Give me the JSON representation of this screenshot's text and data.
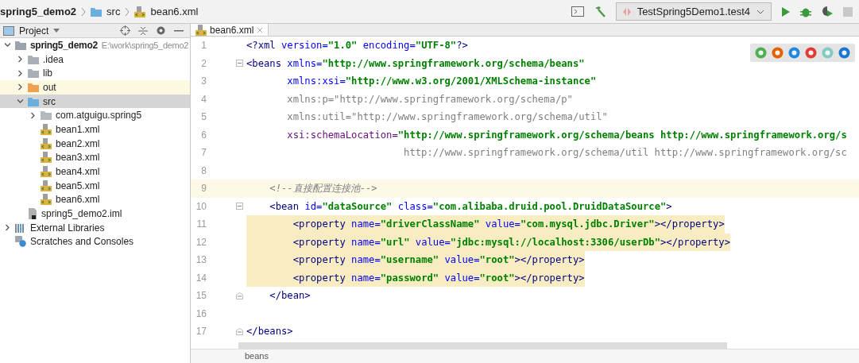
{
  "breadcrumb": [
    {
      "kind": "module",
      "label": "spring5_demo2"
    },
    {
      "kind": "folder",
      "label": "src"
    },
    {
      "kind": "xml",
      "label": "bean6.xml"
    }
  ],
  "run_config": {
    "label": "TestSpring5Demo1.test4"
  },
  "project_panel": {
    "title": "Project"
  },
  "tree": [
    {
      "kind": "module",
      "label": "spring5_demo2",
      "path": "E:\\work\\spring5_demo2",
      "expanded": true,
      "selected": false,
      "children": [
        {
          "kind": "folder",
          "label": ".idea",
          "expanded": false,
          "selected": false
        },
        {
          "kind": "folder",
          "label": "lib",
          "expanded": false,
          "selected": false
        },
        {
          "kind": "excluded",
          "label": "out",
          "expanded": false,
          "selected": false
        },
        {
          "kind": "source",
          "label": "src",
          "expanded": true,
          "selected": true,
          "children": [
            {
              "kind": "package",
              "label": "com.atguigu.spring5",
              "expanded": false,
              "selected": false
            },
            {
              "kind": "xml",
              "label": "bean1.xml",
              "selected": false
            },
            {
              "kind": "xml",
              "label": "bean2.xml",
              "selected": false
            },
            {
              "kind": "xml",
              "label": "bean3.xml",
              "selected": false
            },
            {
              "kind": "xml",
              "label": "bean4.xml",
              "selected": false
            },
            {
              "kind": "xml",
              "label": "bean5.xml",
              "selected": false
            },
            {
              "kind": "xml",
              "label": "bean6.xml",
              "selected": false
            }
          ]
        },
        {
          "kind": "iml",
          "label": "spring5_demo2.iml",
          "selected": false
        }
      ]
    },
    {
      "kind": "libraries",
      "label": "External Libraries",
      "expanded": false,
      "selected": false
    },
    {
      "kind": "scratches",
      "label": "Scratches and Consoles",
      "selected": false
    }
  ],
  "tabs": [
    {
      "label": "bean6.xml",
      "selected": true
    }
  ],
  "code": [
    {
      "number": "1",
      "current": false,
      "matched": false,
      "tokens": [
        {
          "kind": "tag",
          "text": "<?xml"
        },
        {
          "kind": "attr",
          "text": " version="
        },
        {
          "kind": "value",
          "text": "\"1.0\""
        },
        {
          "kind": "attr",
          "text": " encoding="
        },
        {
          "kind": "value",
          "text": "\"UTF-8\""
        },
        {
          "kind": "tag",
          "text": "?>"
        }
      ]
    },
    {
      "number": "2",
      "current": false,
      "matched": false,
      "fold": {
        "kind": "open"
      },
      "tokens": [
        {
          "kind": "tag",
          "text": "<beans"
        },
        {
          "kind": "attr",
          "text": " xmlns="
        },
        {
          "kind": "value",
          "text": "\"http://www.springframework.org/schema/beans\""
        }
      ]
    },
    {
      "number": "3",
      "current": false,
      "matched": false,
      "tokens": [
        {
          "kind": "attr",
          "text": "       xmlns:xsi="
        },
        {
          "kind": "value",
          "text": "\"http://www.w3.org/2001/XMLSchema-instance\""
        }
      ]
    },
    {
      "number": "4",
      "current": false,
      "matched": false,
      "tokens": [
        {
          "kind": "unused",
          "text": "       xmlns:p=\"http://www.springframework.org/schema/p\""
        }
      ]
    },
    {
      "number": "5",
      "current": false,
      "matched": false,
      "tokens": [
        {
          "kind": "unused",
          "text": "       xmlns:util=\"http://www.springframework.org/schema/util\""
        }
      ]
    },
    {
      "number": "6",
      "current": false,
      "matched": false,
      "tokens": [
        {
          "kind": "namespace",
          "text": "       xsi:schemaLocation="
        },
        {
          "kind": "value",
          "text": "\"http://www.springframework.org/schema/beans http://www.springframework.org/s"
        }
      ]
    },
    {
      "number": "7",
      "current": false,
      "matched": false,
      "tokens": [
        {
          "kind": "unused",
          "text": "                           http://www.springframework.org/schema/util http://www.springframework.org/sc"
        }
      ]
    },
    {
      "number": "8",
      "current": false,
      "matched": false
    },
    {
      "number": "9",
      "current": true,
      "matched": false,
      "tokens": [
        {
          "kind": "comment",
          "text": "    <!--直接配置连接池-->"
        }
      ]
    },
    {
      "number": "10",
      "current": false,
      "matched": false,
      "fold": {
        "kind": "open"
      },
      "tokens": [
        {
          "kind": "tag",
          "text": "    <bean"
        },
        {
          "kind": "attr",
          "text": " id="
        },
        {
          "kind": "value",
          "text": "\"dataSource\""
        },
        {
          "kind": "attr",
          "text": " class="
        },
        {
          "kind": "value",
          "text": "\"com.alibaba.druid.pool.DruidDataSource\""
        },
        {
          "kind": "tag",
          "text": ">"
        }
      ]
    },
    {
      "number": "11",
      "current": false,
      "matched": true,
      "tokens": [
        {
          "kind": "tag",
          "text": "        <property"
        },
        {
          "kind": "attr",
          "text": " name="
        },
        {
          "kind": "value",
          "text": "\"driverClassName\""
        },
        {
          "kind": "attr",
          "text": " value="
        },
        {
          "kind": "value",
          "text": "\"com.mysql.jdbc.Driver\""
        },
        {
          "kind": "tag",
          "text": "></property>"
        }
      ]
    },
    {
      "number": "12",
      "current": false,
      "matched": true,
      "tokens": [
        {
          "kind": "tag",
          "text": "        <property"
        },
        {
          "kind": "attr",
          "text": " name="
        },
        {
          "kind": "value",
          "text": "\"url\""
        },
        {
          "kind": "attr",
          "text": " value="
        },
        {
          "kind": "value",
          "text": "\"jdbc:mysql://localhost:3306/userDb\""
        },
        {
          "kind": "tag",
          "text": "></property>"
        }
      ]
    },
    {
      "number": "13",
      "current": false,
      "matched": true,
      "tokens": [
        {
          "kind": "tag",
          "text": "        <property"
        },
        {
          "kind": "attr",
          "text": " name="
        },
        {
          "kind": "value",
          "text": "\"username\""
        },
        {
          "kind": "attr",
          "text": " value="
        },
        {
          "kind": "value",
          "text": "\"root\""
        },
        {
          "kind": "tag",
          "text": "></property>"
        }
      ]
    },
    {
      "number": "14",
      "current": false,
      "matched": true,
      "tokens": [
        {
          "kind": "tag",
          "text": "        <property"
        },
        {
          "kind": "attr",
          "text": " name="
        },
        {
          "kind": "value",
          "text": "\"password\""
        },
        {
          "kind": "attr",
          "text": " value="
        },
        {
          "kind": "value",
          "text": "\"root\""
        },
        {
          "kind": "tag",
          "text": "></property>"
        }
      ]
    },
    {
      "number": "15",
      "current": false,
      "matched": false,
      "fold": {
        "kind": "close"
      },
      "tokens": [
        {
          "kind": "tag",
          "text": "    </bean>"
        }
      ]
    },
    {
      "number": "16",
      "current": false,
      "matched": false
    },
    {
      "number": "17",
      "current": false,
      "matched": false,
      "fold": {
        "kind": "close"
      },
      "tokens": [
        {
          "kind": "tag",
          "text": "</beans>"
        }
      ]
    }
  ],
  "browsers": [
    {
      "color": "#4caf50"
    },
    {
      "color": "#e66000"
    },
    {
      "color": "#1e88e5"
    },
    {
      "color": "#e53935"
    },
    {
      "color": "#80cbc4"
    },
    {
      "color": "#1976d2"
    }
  ],
  "editor_breadcrumb": "beans"
}
